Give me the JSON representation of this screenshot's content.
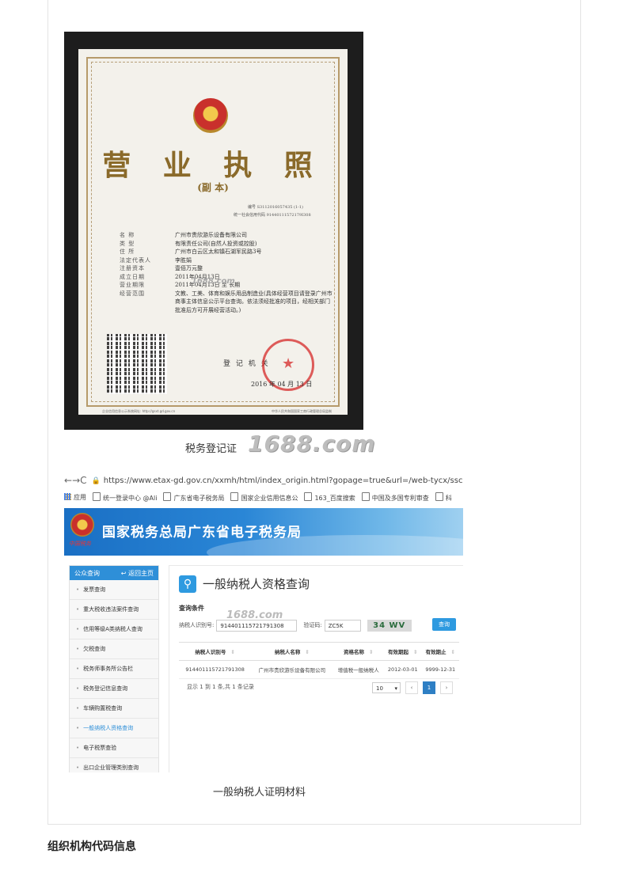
{
  "license": {
    "title": "营 业 执 照",
    "subtitle": "(副  本)",
    "number_line": "编号  S3112016057435    (1-1)",
    "credit_line": "统一社会信用代码 91440111572179I308",
    "fields": [
      {
        "label": "名        称",
        "value": "广州市贵欣游乐设备有限公司"
      },
      {
        "label": "类        型",
        "value": "有限责任公司(自然人投资或控股)"
      },
      {
        "label": "住        所",
        "value": "广州市白云区太和镇石湖军民路3号"
      },
      {
        "label": "法定代表人",
        "value": "李胜娟"
      },
      {
        "label": "注册资本",
        "value": "壹佰万元整"
      },
      {
        "label": "成立日期",
        "value": "2011年04月13日"
      },
      {
        "label": "营业期限",
        "value": "2011年04月13日 至 长期"
      },
      {
        "label": "经营范围",
        "value": "文教、工美、体育和娱乐用品制造业(具体经营项目请登录广州市商事主体信息公示平台查询。依法须经批准的项目，经相关部门批准后方可开展经营活动。)"
      }
    ],
    "watermark_small": "1688.com",
    "registration_office": "登 记 机 关",
    "registration_date": "2016 年 04 月 13 日",
    "footer_left": "企业信用信息公示系统网址: http://gsxt.gd.gov.cn",
    "footer_right": "中华人民共和国国家工商行政管理总局监制"
  },
  "caption1": "税务登记证",
  "watermark_big": "1688.com",
  "browser": {
    "nav": {
      "back": "←",
      "forward": "→",
      "reload": "C"
    },
    "url": "https://www.etax-gd.gov.cn/xxmh/html/index_origin.html?gopage=true&url=/web-tycx/sscx/gzcx/sw",
    "bookmarks": [
      "应用",
      "统一登录中心 @Ali",
      "广东省电子税务局",
      "国家企业信用信息公",
      "163_百度搜索",
      "中国及多国专利审查",
      "科"
    ],
    "banner_title": "国家税务总局广东省电子税务局",
    "logo_text": "中国税务",
    "sidebar": {
      "heading": "公众查询",
      "back": "返回主页",
      "items": [
        "发票查询",
        "重大税收违法案件查询",
        "信用等级A类纳税人查询",
        "欠税查询",
        "税务师事务所公告栏",
        "税务登记信息查询",
        "车辆购置税查询",
        "一般纳税人资格查询",
        "电子税票查验",
        "出口企业管理类别查询"
      ]
    },
    "main": {
      "title": "一般纳税人资格查询",
      "conditions": "查询条件",
      "taxpayer_label": "纳税人识别号:",
      "taxpayer_value": "914401115721791308",
      "captcha_label": "验证码:",
      "captcha_value": "ZC5K",
      "captcha_image": "34 WV",
      "query_button": "查询",
      "watermark": "1688.com",
      "table": {
        "headers": [
          "纳税人识别号",
          "纳税人名称",
          "资格名称",
          "有效期起",
          "有效期止"
        ],
        "rows": [
          [
            "914401115721791308",
            "广州市贵欣游乐设备有限公司",
            "增值税一般纳税人",
            "2012-03-01",
            "9999-12-31"
          ]
        ]
      },
      "pager_text": "显示 1 到 1 条,共 1 条记录",
      "page_size": "10",
      "current_page": "1"
    }
  },
  "caption2": "一般纳税人证明材料",
  "section_heading": "组织机构代码信息"
}
